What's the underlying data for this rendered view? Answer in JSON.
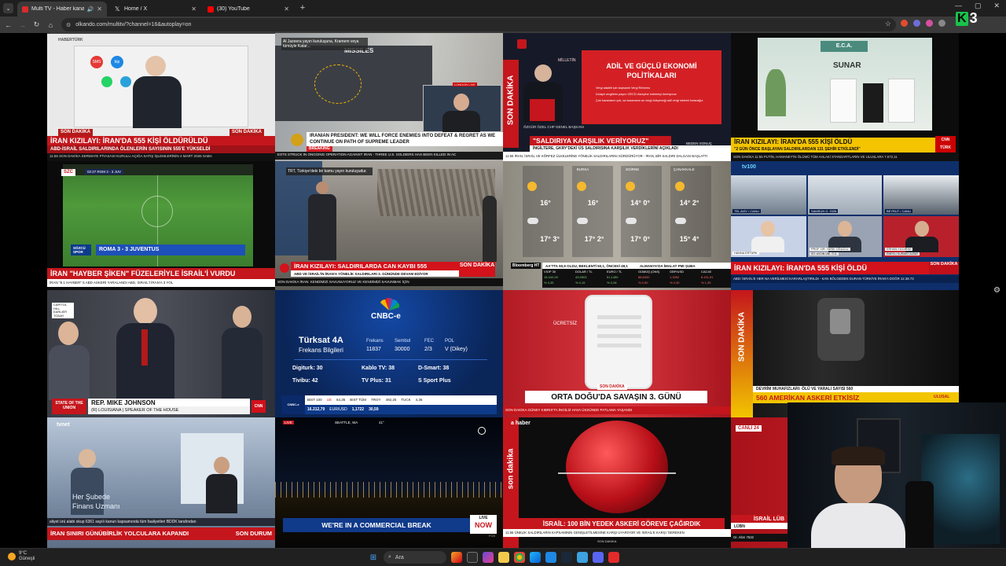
{
  "browser": {
    "tabs": [
      {
        "title": "Multi TV - Haber kanalları",
        "favicon_color": "#d92b2b",
        "active": true
      },
      {
        "title": "Home / X",
        "favicon_color": "#ffffff",
        "active": false
      },
      {
        "title": "(30) YouTube",
        "favicon_color": "#ff0000",
        "active": false
      }
    ],
    "url": "olkando.com/multitv/?channel=16&autoplay=on"
  },
  "overlay": {
    "k3_letter": "K",
    "k3_number": "3"
  },
  "tiles": {
    "haberturk": {
      "logo": "HABERTÜRK",
      "badge": "SON DAKİKA",
      "badge2": "SON DAKİKA",
      "headline": "İRAN KIZILAYI: İRAN'DA 555 KİŞİ ÖLDÜRÜLDÜ",
      "subline": "ABD-İSRAİL SALDIRILARINDA ÖLENLERİN SAYISININ 555'E YÜKSELDİ",
      "ticker": "11:55  SON DAKİKA   SERMAYE PİYASASI KURULU AÇIĞA SATIŞ İŞLEMLERİNİN 4 MART 2026 SABA",
      "app_labels": [
        "SMS",
        "bip"
      ]
    },
    "aljazeera": {
      "caption": "Al Jazeera yayın kuruluşuna, Kramem veya tümüyle Katar...",
      "map_label": "MISSILES",
      "breaking": "BREAKING",
      "headline": "IRANIAN PRESIDENT: WE WILL FORCE ENEMIES INTO DEFEAT & REGRET AS WE CONTINUE ON PATH OF SUPREME LEADER",
      "ticker": "ESTS STRUCK IN ONGOING OPERATION AGAINST IRAN  -  THREE U.S. SOLDIERS HAS BEEN KILLED IN AC",
      "live_label": "LONDON  LIVE"
    },
    "haberglobal": {
      "logo_text": "MİLLETİN",
      "vertical": "SON DAKİKA",
      "slide_title": "ADİL VE GÜÇLÜ EKONOMİ POLİTİKALARI",
      "bullets": [
        "Vergi adaleti için kapsamlı Vergi Reformu",
        "Dolaylı vergilerin payını OECD düzeyine indirmeyi öneriyoruz",
        "Çok kazananın çok, az kazananın az vergi ödeyeceği adil vergi sistemi kuracağız"
      ],
      "speaker": "ÖZGÜR ÖZEL  CHP GENEL BAŞKANI",
      "headline": "\"SALDIRIYA KARŞILIK VERİYORUZ\"",
      "subline": "İNGİLTERE, GKRY'DEKİ ÜS SALDIRISINA KARŞILIK VERDİKLERİNİ AÇIKLADI",
      "ticker": "11:55  İRAN, İSRAİL VE KÖRFEZ ÜLKELERİNE YÖNELİK SALDIRILARINI SÜRDÜRÜYOR  -  İRAN, BİR SALDIRI DALGASI BAŞLATTI",
      "corner": "BEDEN SONUÇ"
    },
    "cnnturk": {
      "brand": "E.C.A.",
      "product": "SUNAR",
      "headline": "İRAN KIZILAYI: İRAN'DA 555 KİŞİ ÖLDÜ",
      "subline": "\"2 GÜN ÖNCE BAŞLAYAN SALDIRILARDAN 131 ŞEHİR ETKİLENDİ\"",
      "ticker": "SON DAKİKA  11:55  PUTİN, HAMANEY'İN ÖLÜMÜ TÜM AHLAKİ STANDARTLARIN VE ULUSLARA  7.672,11",
      "channel": "CNN TÜRK"
    },
    "szcspor": {
      "logo": "SZC",
      "score_top": "02:27  ROM  3 - 3  JUV",
      "score_label": "ROMA 3 - 3 JUVENTUS",
      "brand": "SÖZCÜ SPOR",
      "headline": "İRAN \"HAYBER ŞİKEN\" FÜZELERİYLE İSRAİL'İ VURDU",
      "ticker": "İRAN  \"9.1 HAYBER\" 5 ABD ASKERİ YARALANDI   ABD, İSRAİL'İ İRAN'A 3 YOL"
    },
    "trt": {
      "caption": "TRT, Türkiye'deki bir kamu yayın kuruluşudur.",
      "headline": "İRAN KIZILAYI: SALDIRILARDA CAN KAYBI 555",
      "subline": "ABD VE İSRAİL'İN İRAN'A YÖNELİK SALDIRILARI 3. GÜNÜNDE DEVAM EDİYOR",
      "badge": "SON DAKİKA",
      "ticker": "SON DAKİKA  İRAN: KENDİMİZİ SAVUNUYORUZ VE KENDİMİZİ SAVUNMAK İÇİN"
    },
    "bloomberg": {
      "cities": [
        {
          "name": "",
          "high": "16°",
          "low": "17°"
        },
        {
          "name": "BURSA",
          "high": "16°",
          "low": "17°"
        },
        {
          "name": "EDİRNE",
          "high": "14°",
          "low": "17°"
        },
        {
          "name": "ÇANAKKALE",
          "high": "14°",
          "low": "15°"
        }
      ],
      "high_temps": [
        "16°",
        "16°",
        "14° 0°",
        "14° 2°"
      ],
      "low_temps": [
        "17° 3°",
        "17° 2°",
        "17° 0°",
        "15° 4°"
      ],
      "headline": "AA'TTA 50,9 OLDU, BEKLENTİ 50,1, ÖNCEKİ 49,1",
      "headline_right": "ALMANYA'DA İMALAT PMI ŞUBA",
      "labels": [
        "VİOP 30",
        "DOLAR / TL",
        "EURO / TL",
        "GÜMÜŞ (ONS)",
        "GBP/USD",
        "CAC40"
      ],
      "values": [
        "15.442,00",
        "43,9903",
        "51,1450",
        "88,6000",
        "1,3352",
        "8.431,81"
      ],
      "changes": [
        "% 3,35",
        "% 0,15",
        "% 0,28",
        "% 0,50",
        "% 0,30",
        "% 1,35"
      ],
      "logo": "Bloomberg HT"
    },
    "tv100": {
      "logo": "tv100",
      "cam_labels": [
        "TEL AVİV / CANLI",
        "SAMSUN  G. GÜN",
        "BEYRUT / CANLI"
      ],
      "guests": [
        "HANNA ERTÜRK",
        "PROF. DR. TARIK OĞUZLU",
        "ERHAN YILDIRIM"
      ],
      "guest_titles": [
        "",
        "İST. AYDIN ÜNİ. Ö.Ü.",
        "EMEKLİ KURMAY ALBAY"
      ],
      "headline": "İRAN KIZILAYI: İRAN'DA 555 KİŞİ ÖLDÜ",
      "badge": "SON DAKİKA",
      "ticker": "ABD: İSRAİL'E HER NA VERİLMESİ KARARLAŞTIRILDI  -  KAN BÖLGEDEN DURAN TÜRKİYE İRAN'A DOĞR  12.38.73"
    },
    "cnn": {
      "tag": "CAPITOL HILL  EARLIER TODAY",
      "show": "STATE OF THE UNION",
      "name": "REP. MIKE JOHNSON",
      "title": "(R) LOUISIANA | SPEAKER OF THE HOUSE",
      "network": "CNN"
    },
    "cnbce": {
      "brand": "CNBC-e",
      "title1": "Türksat 4A",
      "title2": "Frekans Bilgileri",
      "cols": [
        {
          "label": "Frekans",
          "value": "11837"
        },
        {
          "label": "Sembol",
          "value": "30000"
        },
        {
          "label": "FEC",
          "value": "2/3"
        },
        {
          "label": "POL",
          "value": "V (Dikey)"
        }
      ],
      "channels": [
        "Digiturk: 30",
        "Kablo TV: 38",
        "D-Smart: 38",
        "Tivibu: 42",
        "TV Plus: 31",
        "S Sport Plus"
      ],
      "ticker_labels": [
        "BIST 100",
        "US",
        "BIST TÜM",
        "EUR/USD",
        "TROY",
        "TUCK"
      ],
      "ticker_values": [
        "16.212,79",
        "64,35",
        "1,1722",
        "492,25",
        "30,59",
        "4,36"
      ],
      "bottom": "BIST SINAİ  16.212,79  EUR/USD  1,1722  TRY/ONS"
    },
    "tgrt": {
      "label": "ÜCRETSİZ",
      "badge": "SON DAKİKA",
      "headline": "ORTA DOĞU'DA SAVAŞIN 3. GÜNÜ",
      "ticker": "SON DAKİKA  GÜNEY KIBRIS'TA İNGİLİZ HAVA ÜSSÜNDE PATLAMA YAŞANDI"
    },
    "dark": {
      "vertical": "SON DAKİKA",
      "subline": "DEVRİM MUHAFIZLARI: ÖLÜ VE YARALI SAYISI 560",
      "headline": "560 AMERİKAN ASKERİ ETKİSİZ",
      "tag": "ULUSAL"
    },
    "tvnet": {
      "logo": "tvnet",
      "promo1": "Her Şubede",
      "promo2": "Finans Uzmanı",
      "strip": "aliyet ürü alabi okup 6361 sayılı kanun kapsamında tüm faaliyetleri BDDK tarafından",
      "headline": "İRAN SINIRI GÜNÜBİRLİK YOLCULARA KAPANDI",
      "badge": "SON DURUM"
    },
    "livenow": {
      "location": "SEATTLE, WA",
      "temp": "41°",
      "headline": "WE'RE IN A COMMERCIAL BREAK",
      "badge1": "LIVE",
      "badge2": "NOW",
      "small": "FOX"
    },
    "ahaber": {
      "logo": "a haber",
      "vertical": "son dakika",
      "headline": "İSRAİL: 100 BİN YEDEK ASKERİ GÖREVE ÇAĞIRDIK",
      "ticker": "11:55  ÜNELİK SALDIRILARIN KAPSAMININ GENİŞLETİLMESİNE KARŞI UYARIYOR VE İSRAİL'E KARŞI 'GEREKEN",
      "small": "SON DAKİKA"
    },
    "canli24": {
      "logo": "CANLI 24",
      "headline": "İSRAİL LÜB",
      "subline": "LÜBN",
      "ticker": "Gr. Altın 7632"
    }
  },
  "taskbar": {
    "weather_temp": "9°C",
    "weather_text": "Güneşli",
    "search": "Ara"
  }
}
